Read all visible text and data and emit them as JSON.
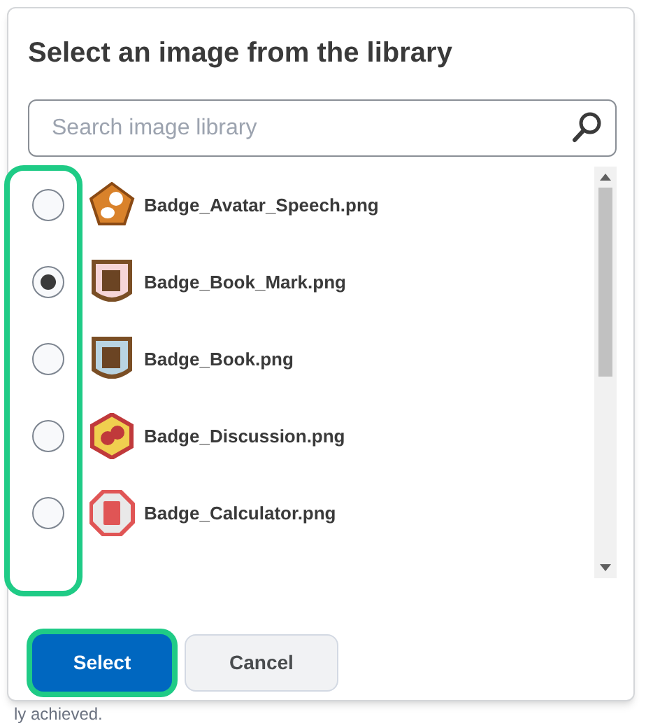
{
  "dialog": {
    "title": "Select an image from the library"
  },
  "search": {
    "placeholder": "Search image library"
  },
  "list": {
    "radio_column_highlighted": true,
    "items": [
      {
        "name": "Badge_Avatar_Speech.png",
        "selected": false,
        "kind": "pentagon",
        "color": "#d9822b"
      },
      {
        "name": "Badge_Book_Mark.png",
        "selected": true,
        "kind": "shield",
        "color": "#f6d5d8"
      },
      {
        "name": "Badge_Book.png",
        "selected": false,
        "kind": "shield",
        "color": "#b9d4e2"
      },
      {
        "name": "Badge_Discussion.png",
        "selected": false,
        "kind": "hexagon",
        "color": "#f0cf4f"
      },
      {
        "name": "Badge_Calculator.png",
        "selected": false,
        "kind": "octagon",
        "color": "#e9e9e9"
      }
    ]
  },
  "buttons": [
    {
      "label": "Select",
      "kind": "primary",
      "highlighted": true
    },
    {
      "label": "Cancel",
      "kind": "secondary",
      "highlighted": false
    }
  ],
  "background_text": "ly achieved."
}
